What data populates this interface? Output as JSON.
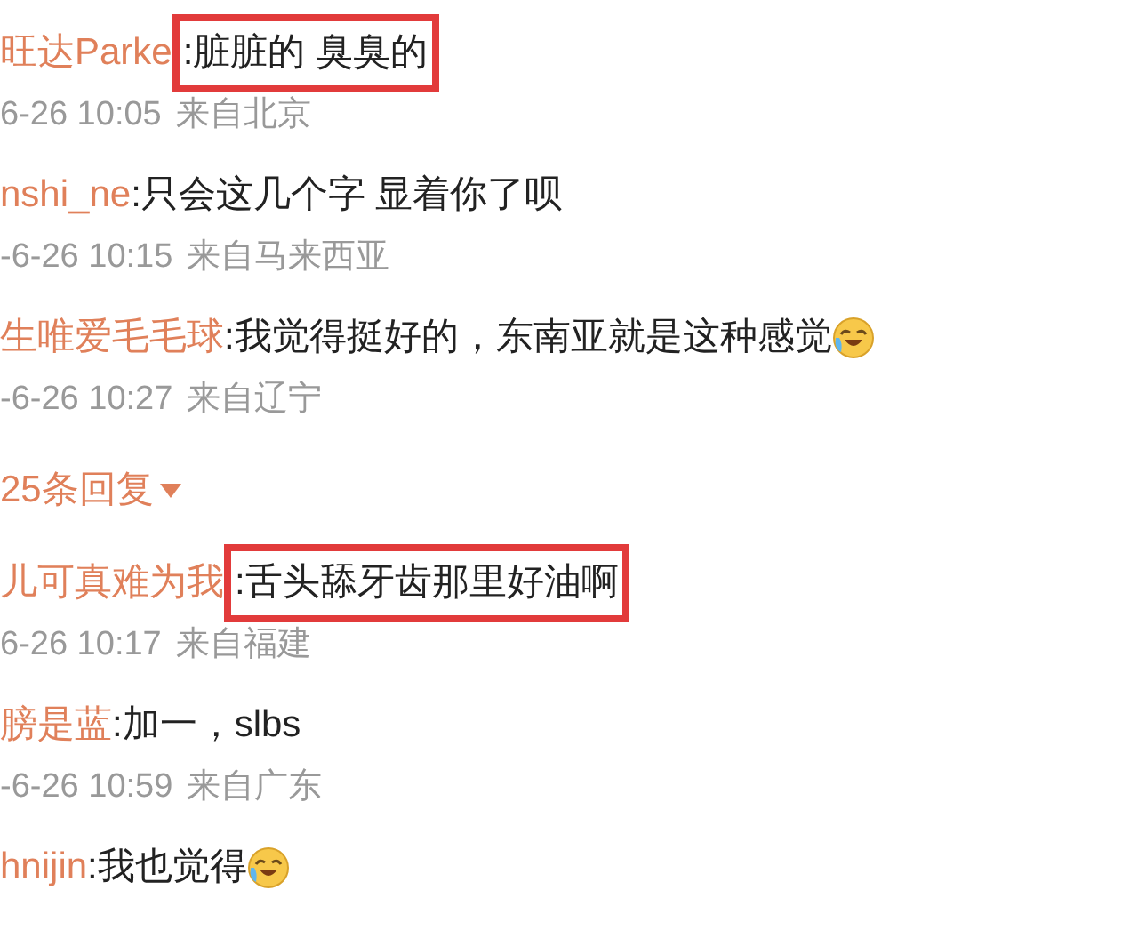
{
  "comments": [
    {
      "kind": "comment",
      "user": "旺达Parke",
      "text": ":脏脏的 臭臭的",
      "highlighted": true,
      "emoji": false,
      "time": "6-26 10:05",
      "location": "来自北京"
    },
    {
      "kind": "comment",
      "user": "nshi_ne",
      "text": ":只会这几个字 显着你了呗",
      "highlighted": false,
      "emoji": false,
      "time": "-6-26 10:15",
      "location": "来自马来西亚"
    },
    {
      "kind": "comment",
      "user": "生唯爱毛毛球",
      "text": ":我觉得挺好的，东南亚就是这种感觉",
      "highlighted": false,
      "emoji": true,
      "time": "-6-26 10:27",
      "location": "来自辽宁"
    },
    {
      "kind": "replies",
      "label": "25条回复"
    },
    {
      "kind": "comment",
      "user": "儿可真难为我",
      "text": ":舌头舔牙齿那里好油啊",
      "highlighted": true,
      "emoji": false,
      "time": "6-26 10:17",
      "location": "来自福建"
    },
    {
      "kind": "comment",
      "user": "膀是蓝",
      "text": ":加一，slbs",
      "highlighted": false,
      "emoji": false,
      "time": "-6-26 10:59",
      "location": "来自广东"
    },
    {
      "kind": "comment",
      "user": "hnijin",
      "text": ":我也觉得",
      "highlighted": false,
      "emoji": true
    }
  ]
}
